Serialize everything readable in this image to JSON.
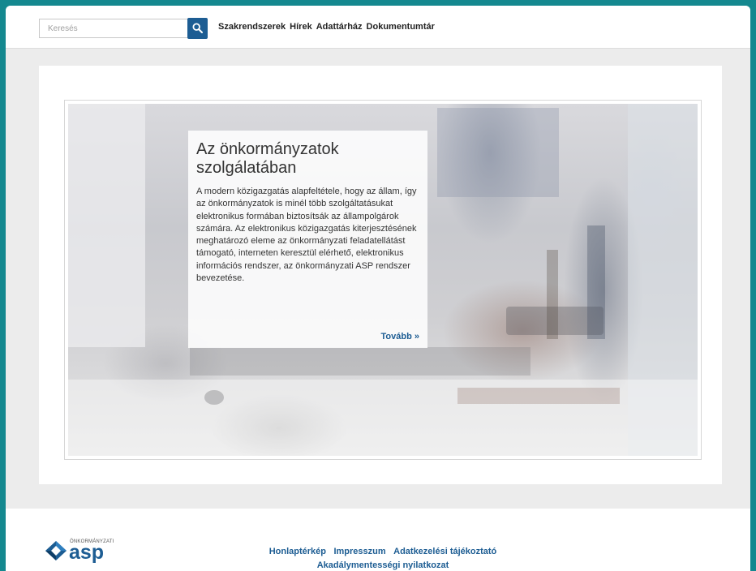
{
  "search": {
    "placeholder": "Keresés"
  },
  "nav": {
    "items": [
      {
        "label": "Szakrendszerek"
      },
      {
        "label": "Hírek"
      },
      {
        "label": "Adattárház"
      },
      {
        "label": "Dokumentumtár"
      }
    ]
  },
  "hero": {
    "title": "Az önkormányzatok szolgálatában",
    "body": "A modern közigazgatás alapfeltétele, hogy az állam, így az önkormányzatok is minél több szolgáltatásukat elektronikus formában biztosítsák az állampolgárok számára. Az elektronikus közigazgatás kiterjesztésének meghatározó eleme az önkormányzati feladatellátást támogató, interneten keresztül elérhető, elektronikus információs rendszer, az önkormányzati ASP rendszer bevezetése.",
    "more_label": "Tovább »"
  },
  "footer": {
    "logo_small": "ÖNKORMÁNYZATI",
    "logo_big": "asp",
    "links": [
      {
        "label": "Honlaptérkép"
      },
      {
        "label": "Impresszum"
      },
      {
        "label": "Adatkezelési tájékoztató"
      },
      {
        "label": "Akadálymentességi nyilatkozat"
      }
    ]
  },
  "colors": {
    "accent": "#1d5d93",
    "frame": "#14888f",
    "page_bg": "#ececec"
  },
  "icons": {
    "search": "search-icon",
    "logo": "asp-logo-icon"
  }
}
